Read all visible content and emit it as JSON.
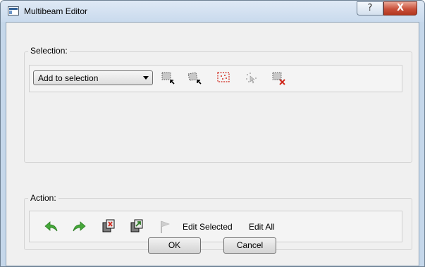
{
  "window": {
    "title": "Multibeam Editor",
    "help_label": "?",
    "close_label": "X"
  },
  "selection": {
    "group_title": "Selection:",
    "mode_value": "Add to selection"
  },
  "action": {
    "group_title": "Action:",
    "edit_selected_label": "Edit Selected",
    "edit_all_label": "Edit All"
  },
  "footer": {
    "ok_label": "OK",
    "cancel_label": "Cancel"
  },
  "icons": {
    "rect_select": "rectangle-select-icon",
    "polygon_select": "polygon-select-icon",
    "select_all": "select-all-icon",
    "point_select": "point-select-icon",
    "clear_selection": "clear-selection-icon",
    "undo": "undo-icon",
    "redo": "redo-icon",
    "reject": "reject-icon",
    "accept": "accept-icon",
    "flag": "flag-icon"
  },
  "colors": {
    "accent_green": "#3c9b2e",
    "accent_red": "#d0281c",
    "close_red": "#c9503a"
  }
}
